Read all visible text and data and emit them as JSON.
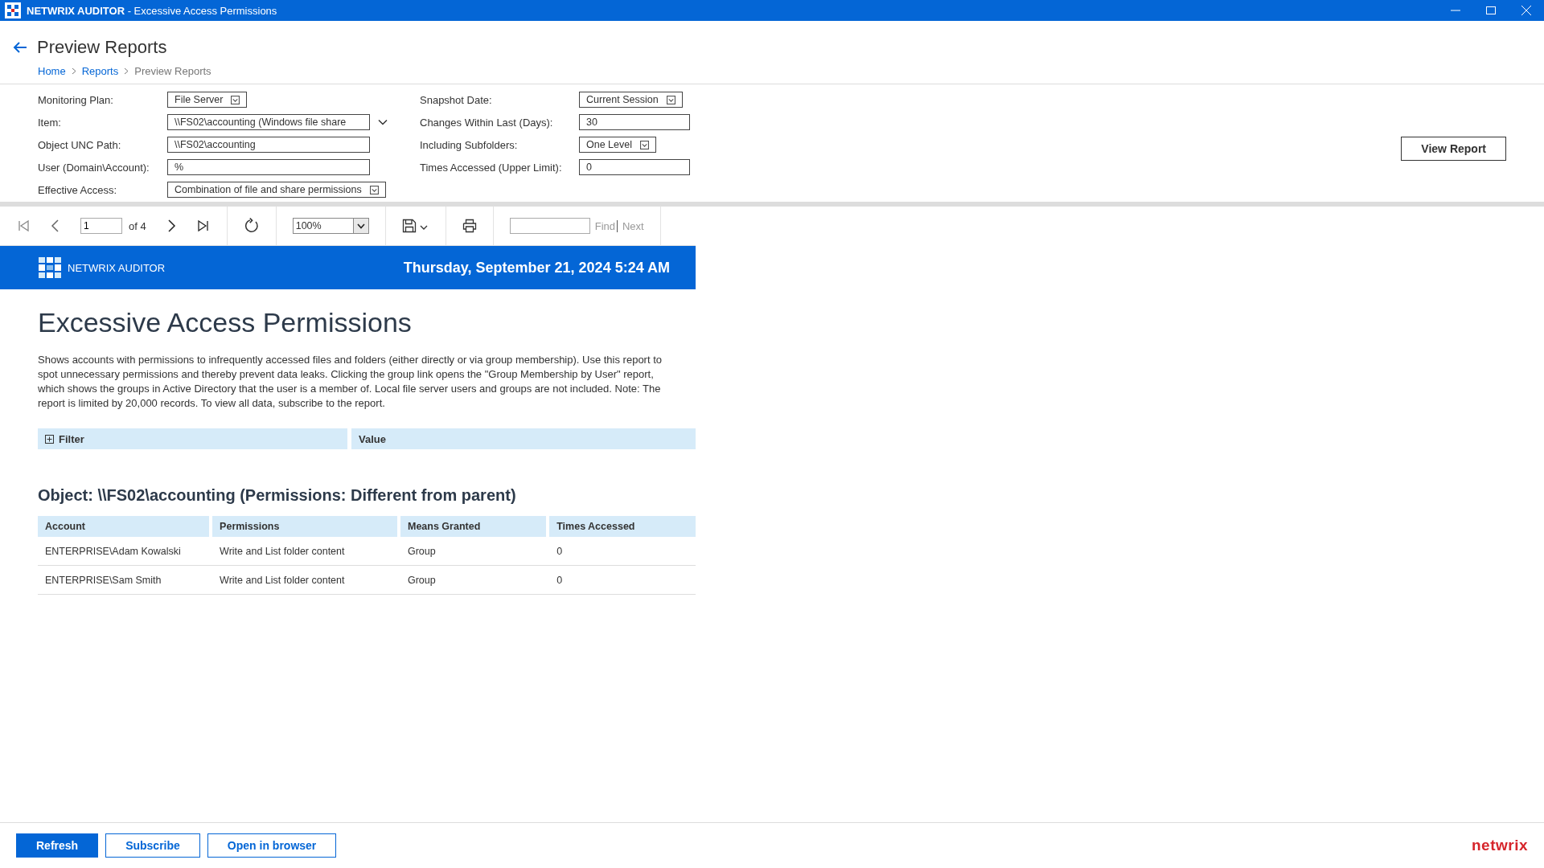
{
  "window": {
    "app_name": "NETWRIX AUDITOR",
    "title": " - Excessive Access Permissions"
  },
  "page": {
    "title": "Preview Reports",
    "breadcrumb": [
      {
        "label": "Home",
        "link": true
      },
      {
        "label": "Reports",
        "link": true
      },
      {
        "label": "Preview Reports",
        "link": false
      }
    ]
  },
  "parameters_left": [
    {
      "label": "Monitoring Plan:",
      "value": "File Server",
      "kind": "dropdown"
    },
    {
      "label": "Item:",
      "value": "\\\\FS02\\accounting (Windows file share",
      "kind": "combo"
    },
    {
      "label": "Object UNC Path:",
      "value": "\\\\FS02\\accounting",
      "kind": "text"
    },
    {
      "label": "User (Domain\\Account):",
      "value": "%",
      "kind": "text"
    },
    {
      "label": "Effective Access:",
      "value": "Combination of file and share permissions",
      "kind": "dropdown"
    }
  ],
  "parameters_right": [
    {
      "label": "Snapshot Date:",
      "value": "Current Session",
      "kind": "dropdown"
    },
    {
      "label": "Changes Within Last (Days):",
      "value": "30",
      "kind": "text"
    },
    {
      "label": "Including Subfolders:",
      "value": "One Level",
      "kind": "dropdown"
    },
    {
      "label": "Times Accessed (Upper Limit):",
      "value": "0",
      "kind": "text"
    }
  ],
  "view_report_button": "View Report",
  "toolbar": {
    "page": "1",
    "page_count": "of 4",
    "zoom": "100%",
    "find_button": "Find",
    "next_button": "Next"
  },
  "report": {
    "brand": "NETWRIX AUDITOR",
    "date": "Thursday, September 21, 2024 5:24 AM",
    "title": "Excessive Access Permissions",
    "description": "Shows accounts with permissions to infrequently accessed files and folders (either directly or via group membership). Use this report to spot unnecessary permissions and thereby prevent data leaks. Clicking the group link opens the \"Group Membership by User\" report, which shows the groups in Active Directory that the user is a member of. Local file server users and groups are not included. Note: The report is limited by 20,000 records. To view all data, subscribe to the report.",
    "filter": {
      "columns": [
        "Filter",
        "Value"
      ],
      "expanded": false
    },
    "object_heading": "Object: \\\\FS02\\accounting (Permissions: Different from parent)",
    "table": {
      "columns": [
        "Account",
        "Permissions",
        "Means Granted",
        "Times Accessed"
      ],
      "rows": [
        [
          "ENTERPRISE\\Adam Kowalski",
          "Write and List folder content",
          "Group",
          "0"
        ],
        [
          "ENTERPRISE\\Sam Smith",
          "Write and List folder content",
          "Group",
          "0"
        ]
      ]
    }
  },
  "footer": {
    "buttons": [
      {
        "label": "Refresh",
        "primary": true
      },
      {
        "label": "Subscribe",
        "primary": false
      },
      {
        "label": "Open in browser",
        "primary": false
      }
    ],
    "brand": "netwrix"
  }
}
